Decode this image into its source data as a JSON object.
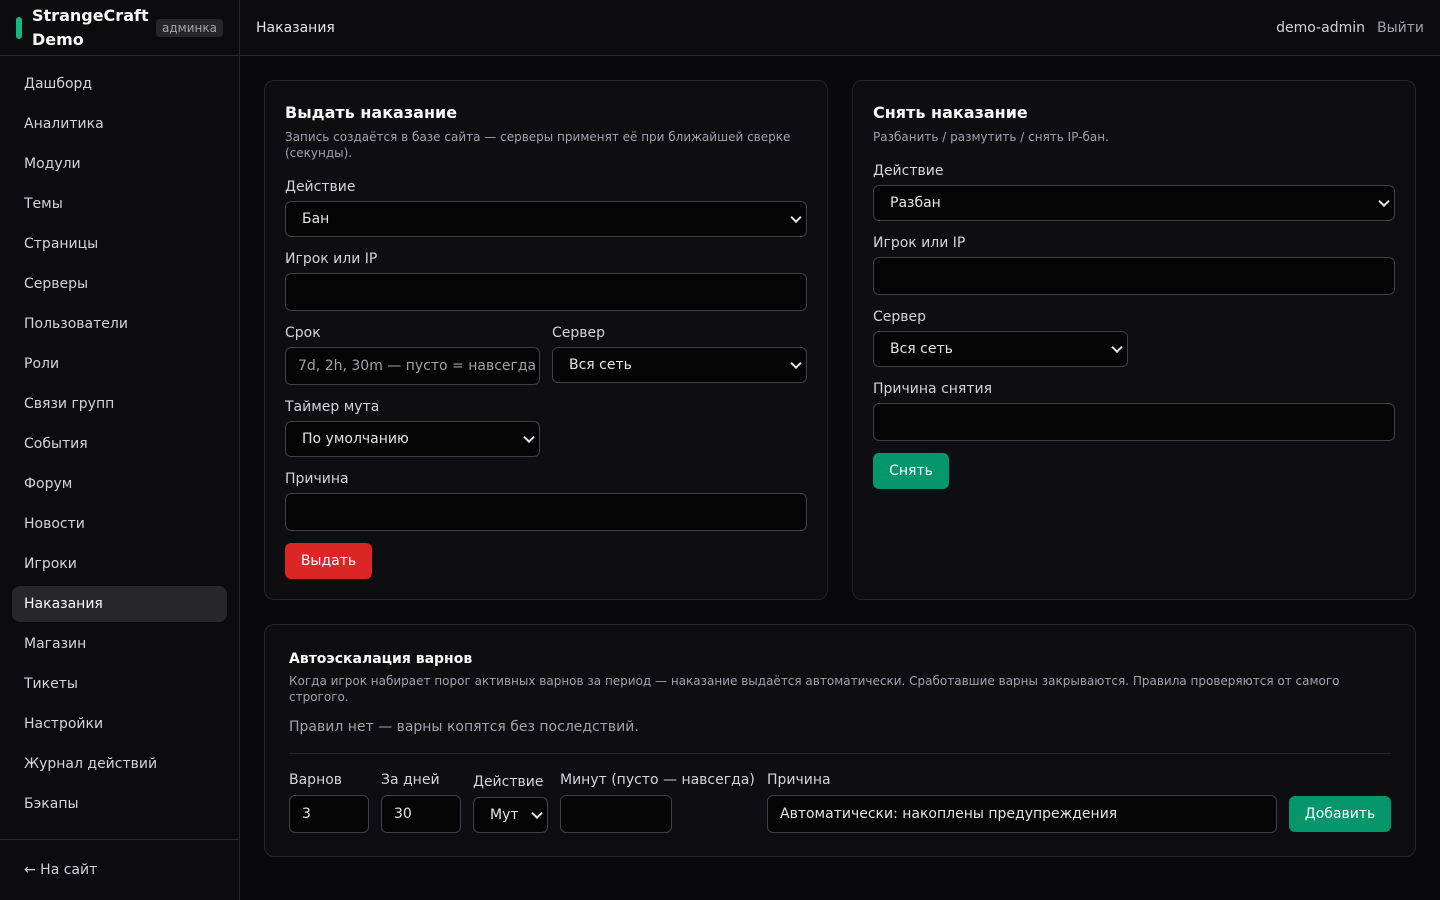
{
  "brand": {
    "name": "StrangeCraft Demo",
    "badge": "админка",
    "accent": "#10b981"
  },
  "nav": {
    "items": [
      {
        "label": "Дашборд"
      },
      {
        "label": "Аналитика"
      },
      {
        "label": "Модули"
      },
      {
        "label": "Темы"
      },
      {
        "label": "Страницы"
      },
      {
        "label": "Серверы"
      },
      {
        "label": "Пользователи"
      },
      {
        "label": "Роли"
      },
      {
        "label": "Связи групп"
      },
      {
        "label": "События"
      },
      {
        "label": "Форум"
      },
      {
        "label": "Новости"
      },
      {
        "label": "Игроки"
      },
      {
        "label": "Наказания"
      },
      {
        "label": "Магазин"
      },
      {
        "label": "Тикеты"
      },
      {
        "label": "Настройки"
      },
      {
        "label": "Журнал действий"
      },
      {
        "label": "Бэкапы"
      }
    ],
    "active": "Наказания",
    "back": "← На сайт"
  },
  "header": {
    "title": "Наказания",
    "user": "demo-admin",
    "logout": "Выйти"
  },
  "issue": {
    "title": "Выдать наказание",
    "desc": "Запись создаётся в базе сайта — серверы применят её при ближайшей сверке (секунды).",
    "action_label": "Действие",
    "action_value": "Бан",
    "target_label": "Игрок или IP",
    "target_value": "",
    "duration_label": "Срок",
    "duration_placeholder": "7d, 2h, 30m — пусто = навсегда",
    "server_label": "Сервер",
    "server_value": "Вся сеть",
    "mute_label": "Таймер мута",
    "mute_value": "По умолчанию",
    "reason_label": "Причина",
    "reason_value": "",
    "submit": "Выдать",
    "submit_color": "#dc2626"
  },
  "revoke": {
    "title": "Снять наказание",
    "desc": "Разбанить / размутить / снять IP-бан.",
    "action_label": "Действие",
    "action_value": "Разбан",
    "target_label": "Игрок или IP",
    "target_value": "",
    "server_label": "Сервер",
    "server_value": "Вся сеть",
    "reason_label": "Причина снятия",
    "reason_value": "",
    "submit": "Снять",
    "submit_color": "#059669"
  },
  "escalation": {
    "title": "Автоэскалация варнов",
    "desc": "Когда игрок набирает порог активных варнов за период — наказание выдаётся автоматически. Сработавшие варны закрываются. Правила проверяются от самого строгого.",
    "empty": "Правил нет — варны копятся без последствий.",
    "warns_label": "Варнов",
    "warns_value": "3",
    "days_label": "За дней",
    "days_value": "30",
    "action_label": "Действие",
    "action_value": "Мут",
    "minutes_label": "Минут (пусто — навсегда)",
    "minutes_value": "",
    "reason_label": "Причина",
    "reason_value": "Автоматически: накоплены предупреждения",
    "add": "Добавить"
  }
}
